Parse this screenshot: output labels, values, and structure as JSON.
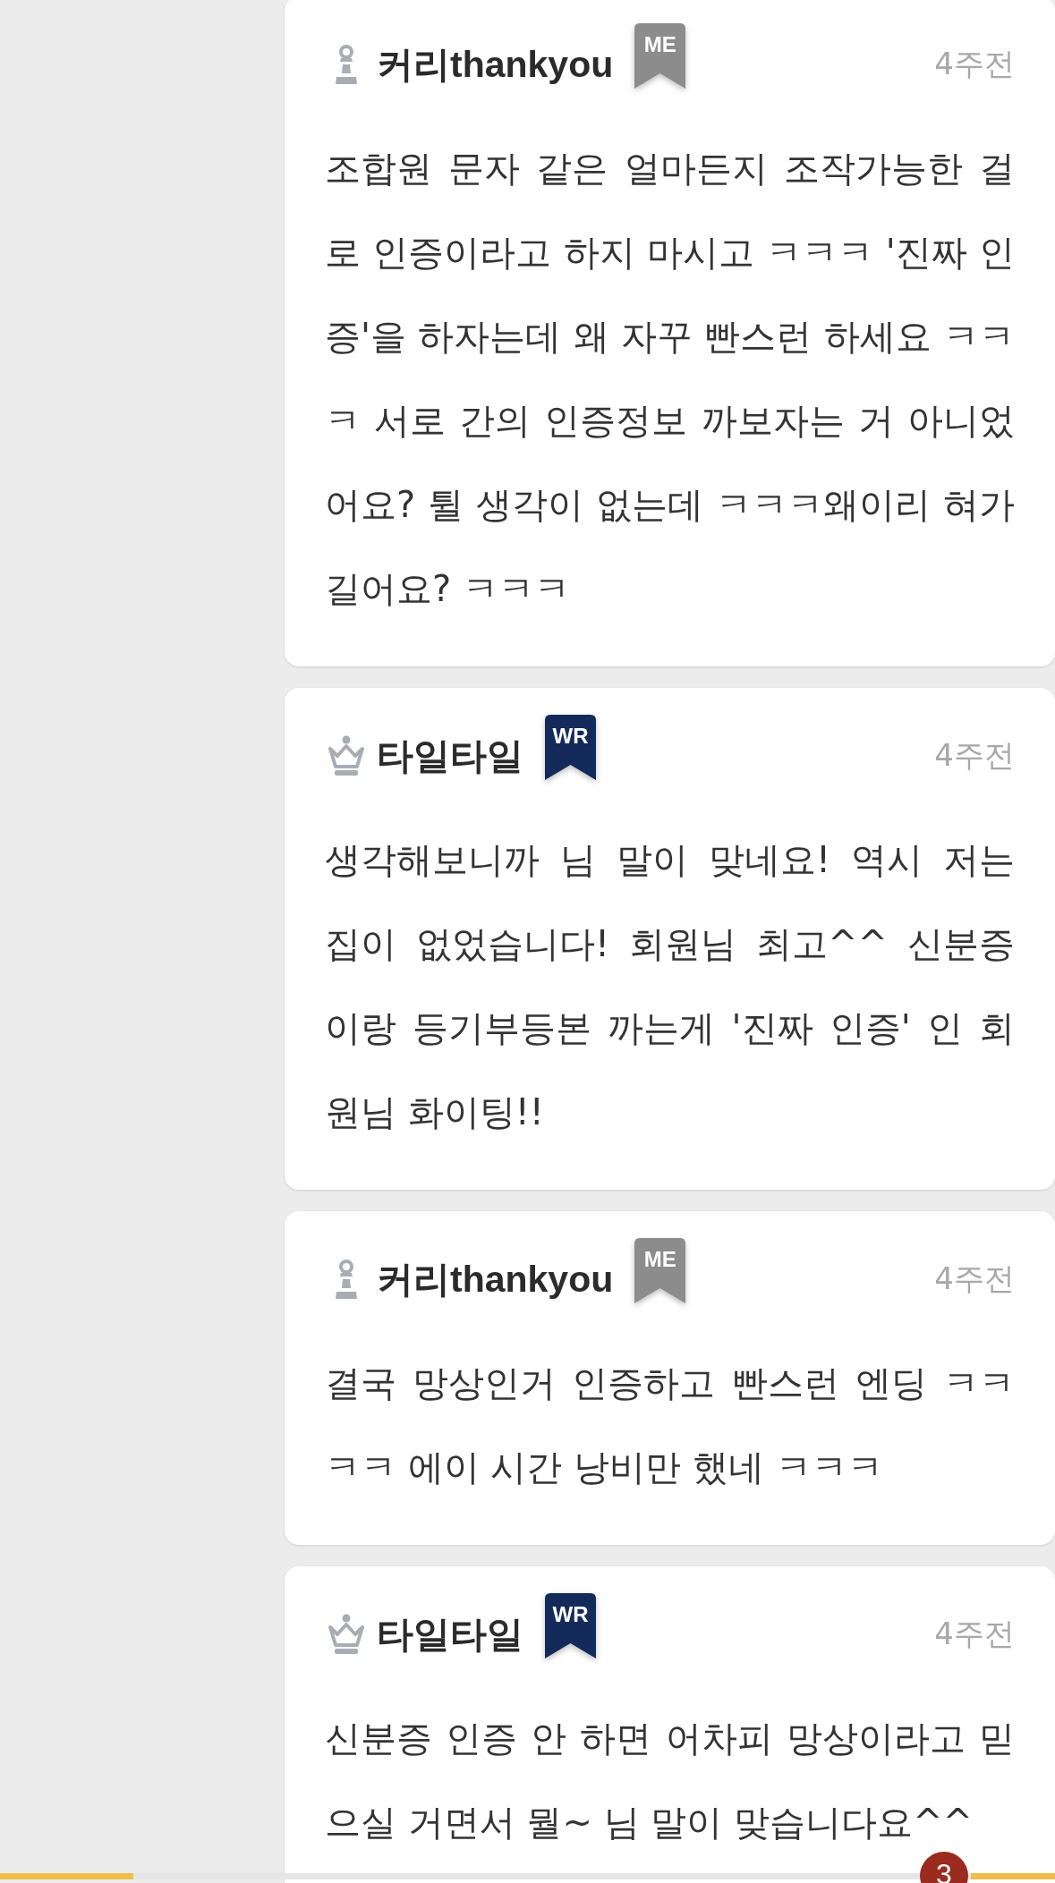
{
  "comments": [
    {
      "kind": "member",
      "author": "커리thankyou",
      "tag": {
        "label": "ME",
        "color": "#8c8c8c"
      },
      "time": "4주전",
      "text": "조합원 문자 같은 얼마든지 조작가능한 걸로 인증이라고 하지 마시고 ㅋㅋㅋ '진짜 인증'을 하자는데 왜 자꾸 빤스런 하세요 ㅋㅋㅋ 서로 간의 인증정보 까보자는 거 아니었어요? 튈 생각이 없는데 ㅋㅋㅋ왜이리 혀가 길어요? ㅋㅋㅋ"
    },
    {
      "kind": "writer",
      "author": "타일타일",
      "tag": {
        "label": "WR",
        "color": "#132a5a"
      },
      "time": "4주전",
      "text": "생각해보니까 님 말이 맞네요! 역시 저는 집이 없었습니다! 회원님 최고^^ 신분증이랑 등기부등본 까는게 '진짜 인증' 인 회원님 화이팅!!"
    },
    {
      "kind": "member",
      "author": "커리thankyou",
      "tag": {
        "label": "ME",
        "color": "#8c8c8c"
      },
      "time": "4주전",
      "text": "결국 망상인거 인증하고 빤스런 엔딩 ㅋㅋㅋㅋ 에이 시간 낭비만 했네 ㅋㅋㅋ"
    },
    {
      "kind": "writer",
      "author": "타일타일",
      "tag": {
        "label": "WR",
        "color": "#132a5a"
      },
      "time": "4주전",
      "text": "신분증 인증 안 하면 어차피 망상이라고 믿으실 거면서 뭘~ 님 말이 맞습니다요^^"
    }
  ],
  "bottom_bar": {
    "badge": "3"
  }
}
